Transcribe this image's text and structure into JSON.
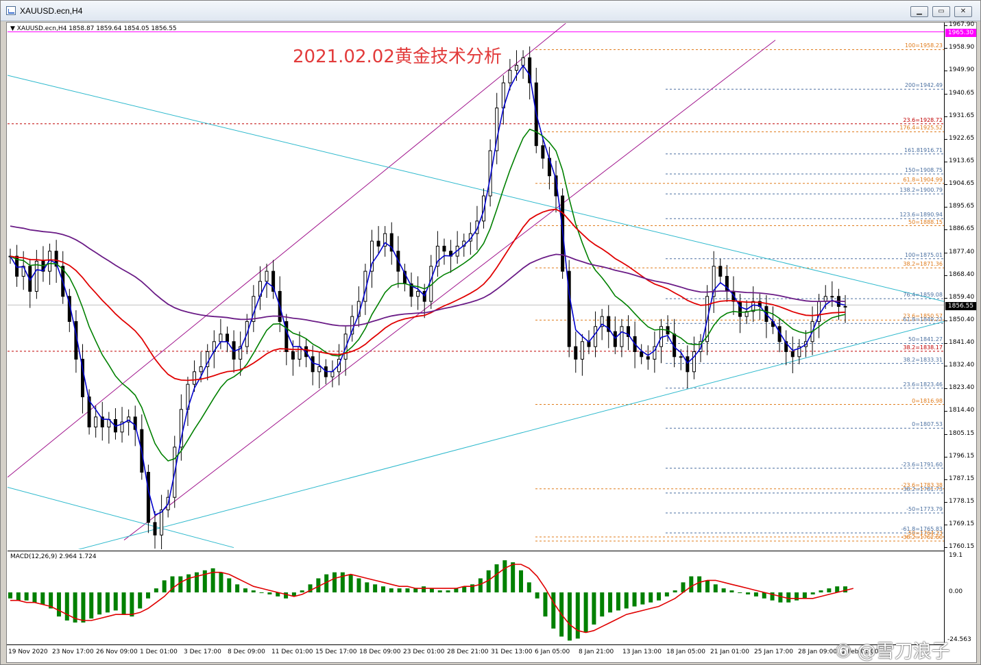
{
  "window": {
    "title": "XAUUSD.ecn,H4",
    "min_symbol": "▁",
    "max_symbol": "▭",
    "close_symbol": "✕"
  },
  "chart": {
    "info": "▼ XAUUSD.ecn,H4  1858.87 1859.64 1854.05 1856.55",
    "headline": "2021.02.02黄金技术分析",
    "current_price_label": "1856.55",
    "alert_price_label": "1965.30",
    "colors": {
      "bull": "#000000",
      "bear": "#000000",
      "ema_fast": "#0000cc",
      "ema_mid": "#008000",
      "ema_slow": "#e00000",
      "ema_long": "#6a1b86",
      "trend": "#2bb8cc",
      "channel": "#a0148c",
      "alert": "#ff00ff",
      "fibo_blue": "#4a6fa0",
      "fibo_orange": "#e07b1a",
      "fibo_red": "#c00000"
    }
  },
  "price_axis": {
    "ticks": [
      "1967.90",
      "1958.90",
      "1949.90",
      "1940.65",
      "1931.65",
      "1922.65",
      "1913.65",
      "1904.65",
      "1895.65",
      "1886.65",
      "1877.40",
      "1868.40",
      "1859.40",
      "1850.40",
      "1841.40",
      "1832.40",
      "1823.40",
      "1814.40",
      "1805.15",
      "1796.15",
      "1787.15",
      "1778.15",
      "1769.15",
      "1760.15"
    ]
  },
  "fibo_labels": [
    {
      "text": "100=1875.01",
      "color": "blue",
      "price": 1875.01
    },
    {
      "text": "200=1942.49",
      "color": "blue",
      "price": 1942.49
    },
    {
      "text": "161.81916.71",
      "color": "blue",
      "price": 1916.71
    },
    {
      "text": "150=1908.75",
      "color": "blue",
      "price": 1908.75
    },
    {
      "text": "138.2=1900.79",
      "color": "blue",
      "price": 1900.79
    },
    {
      "text": "123.6=1890.94",
      "color": "blue",
      "price": 1890.94
    },
    {
      "text": "76.4=1859.08",
      "color": "blue",
      "price": 1859.08
    },
    {
      "text": "50=1841.27",
      "color": "blue",
      "price": 1841.27
    },
    {
      "text": "38.2=1833.31",
      "color": "blue",
      "price": 1833.31
    },
    {
      "text": "23.6=1823.46",
      "color": "blue",
      "price": 1823.46
    },
    {
      "text": "0=1807.53",
      "color": "blue",
      "price": 1807.53
    },
    {
      "text": "-23.6=1791.60",
      "color": "blue",
      "price": 1791.6
    },
    {
      "text": "-50=1773.79",
      "color": "blue",
      "price": 1773.79
    },
    {
      "text": "-61.8=1765.83",
      "color": "blue",
      "price": 1765.83
    },
    {
      "text": "100=1958.23",
      "color": "orange",
      "price": 1958.23
    },
    {
      "text": "176.4=1925.52",
      "color": "orange",
      "price": 1925.52
    },
    {
      "text": "61.8=1904.99",
      "color": "orange",
      "price": 1904.99
    },
    {
      "text": "50=1888.15",
      "color": "orange",
      "price": 1888.15
    },
    {
      "text": "38.2=1871.36",
      "color": "orange",
      "price": 1871.36
    },
    {
      "text": "23.6=1850.57",
      "color": "orange",
      "price": 1850.57
    },
    {
      "text": "61.8=1849.23",
      "color": "blue",
      "price": 1849.23
    },
    {
      "text": "0=1816.98",
      "color": "orange",
      "price": 1816.98
    },
    {
      "text": "-23.6=1783.38",
      "color": "orange",
      "price": 1783.38
    },
    {
      "text": "-38.2=1781.73",
      "color": "blue",
      "price": 1781.73
    },
    {
      "text": "-50=1764.23",
      "color": "orange",
      "price": 1764.23
    },
    {
      "text": "-38.2=1762.60",
      "color": "orange",
      "price": 1762.6
    },
    {
      "text": "23.6=1928.72",
      "color": "red",
      "price": 1928.72
    },
    {
      "text": "38.2=1838.17",
      "color": "red",
      "price": 1838.17
    }
  ],
  "macd": {
    "info": "MACD(12,26,9) 2.964 1.724",
    "axis_top": "19.1",
    "axis_zero": "0.00",
    "axis_bottom": "-24.563"
  },
  "time_axis": {
    "labels": [
      "19 Nov 2020",
      "23 Nov 17:00",
      "26 Nov 09:00",
      "1 Dec 01:00",
      "3 Dec 17:00",
      "8 Dec 09:00",
      "11 Dec 01:00",
      "15 Dec 17:00",
      "18 Dec 09:00",
      "23 Dec 01:00",
      "28 Dec 21:00",
      "31 Dec 13:00",
      "6 Jan 05:00",
      "8 Jan 21:00",
      "13 Jan 13:00",
      "18 Jan 05:00",
      "21 Jan 01:00",
      "25 Jan 17:00",
      "28 Jan 09:00",
      "2 Feb 01:00"
    ]
  },
  "chart_data": {
    "type": "candlestick",
    "symbol": "XAUUSD.ecn",
    "timeframe": "H4",
    "ylim": [
      1760.15,
      1967.9
    ],
    "ohlc_last": {
      "open": 1858.87,
      "high": 1859.64,
      "low": 1854.05,
      "close": 1856.55
    },
    "price_path": [
      1876,
      1868,
      1872,
      1862,
      1874,
      1870,
      1878,
      1872,
      1860,
      1850,
      1835,
      1820,
      1808,
      1812,
      1808,
      1811,
      1806,
      1810,
      1812,
      1807,
      1790,
      1770,
      1765,
      1775,
      1780,
      1800,
      1815,
      1825,
      1830,
      1832,
      1838,
      1842,
      1845,
      1842,
      1835,
      1840,
      1850,
      1860,
      1866,
      1870,
      1862,
      1850,
      1838,
      1835,
      1840,
      1836,
      1830,
      1832,
      1828,
      1830,
      1835,
      1845,
      1852,
      1858,
      1870,
      1882,
      1880,
      1885,
      1878,
      1870,
      1865,
      1860,
      1862,
      1858,
      1872,
      1880,
      1878,
      1876,
      1880,
      1882,
      1885,
      1890,
      1900,
      1918,
      1935,
      1945,
      1950,
      1952,
      1955,
      1945,
      1920,
      1915,
      1908,
      1900,
      1870,
      1840,
      1835,
      1842,
      1840,
      1848,
      1852,
      1846,
      1840,
      1848,
      1844,
      1838,
      1836,
      1835,
      1840,
      1848,
      1845,
      1836,
      1836,
      1830,
      1838,
      1842,
      1860,
      1872,
      1868,
      1862,
      1858,
      1852,
      1854,
      1858,
      1856,
      1850,
      1848,
      1842,
      1838,
      1836,
      1840,
      1842,
      1850,
      1858,
      1860,
      1860,
      1856,
      1856
    ],
    "macd_path": [
      -3,
      -4,
      -4,
      -5,
      -6,
      -8,
      -12,
      -14,
      -15,
      -15,
      -13,
      -11,
      -10,
      -9,
      -11,
      -12,
      -8,
      -3,
      2,
      6,
      8,
      8,
      9,
      10,
      11,
      12,
      10,
      7,
      4,
      2,
      1,
      0,
      -1,
      -2,
      -3,
      -2,
      1,
      4,
      7,
      9,
      10,
      10,
      9,
      7,
      5,
      4,
      3,
      2,
      2,
      2,
      2,
      3,
      2,
      1,
      1,
      2,
      3,
      4,
      7,
      11,
      14,
      16,
      15,
      11,
      5,
      -3,
      -12,
      -18,
      -22,
      -24,
      -23,
      -20,
      -16,
      -12,
      -10,
      -9,
      -8,
      -7,
      -6,
      -5,
      -4,
      -2,
      1,
      5,
      8,
      8,
      6,
      4,
      2,
      1,
      0,
      -1,
      -2,
      -3,
      -4,
      -5,
      -5,
      -4,
      -3,
      -1,
      1,
      2,
      3,
      3
    ],
    "signal_path": [
      -4,
      -4,
      -5,
      -5,
      -6,
      -7,
      -9,
      -11,
      -13,
      -14,
      -14,
      -13,
      -12,
      -11,
      -11,
      -11,
      -10,
      -8,
      -5,
      -2,
      2,
      5,
      7,
      8,
      9,
      10,
      10,
      9,
      7,
      5,
      3,
      2,
      1,
      0,
      -1,
      -2,
      -1,
      1,
      3,
      5,
      7,
      8,
      9,
      8,
      7,
      6,
      5,
      4,
      3,
      3,
      2,
      2,
      2,
      2,
      2,
      2,
      3,
      3,
      4,
      6,
      9,
      12,
      14,
      14,
      12,
      8,
      2,
      -5,
      -11,
      -16,
      -19,
      -20,
      -19,
      -17,
      -15,
      -13,
      -11,
      -10,
      -9,
      -8,
      -7,
      -5,
      -3,
      0,
      3,
      5,
      6,
      6,
      5,
      4,
      3,
      2,
      1,
      0,
      -1,
      -2,
      -3,
      -3,
      -3,
      -3,
      -2,
      -1,
      0,
      1,
      2
    ]
  },
  "watermark": "⑥ @雪刀浪子"
}
